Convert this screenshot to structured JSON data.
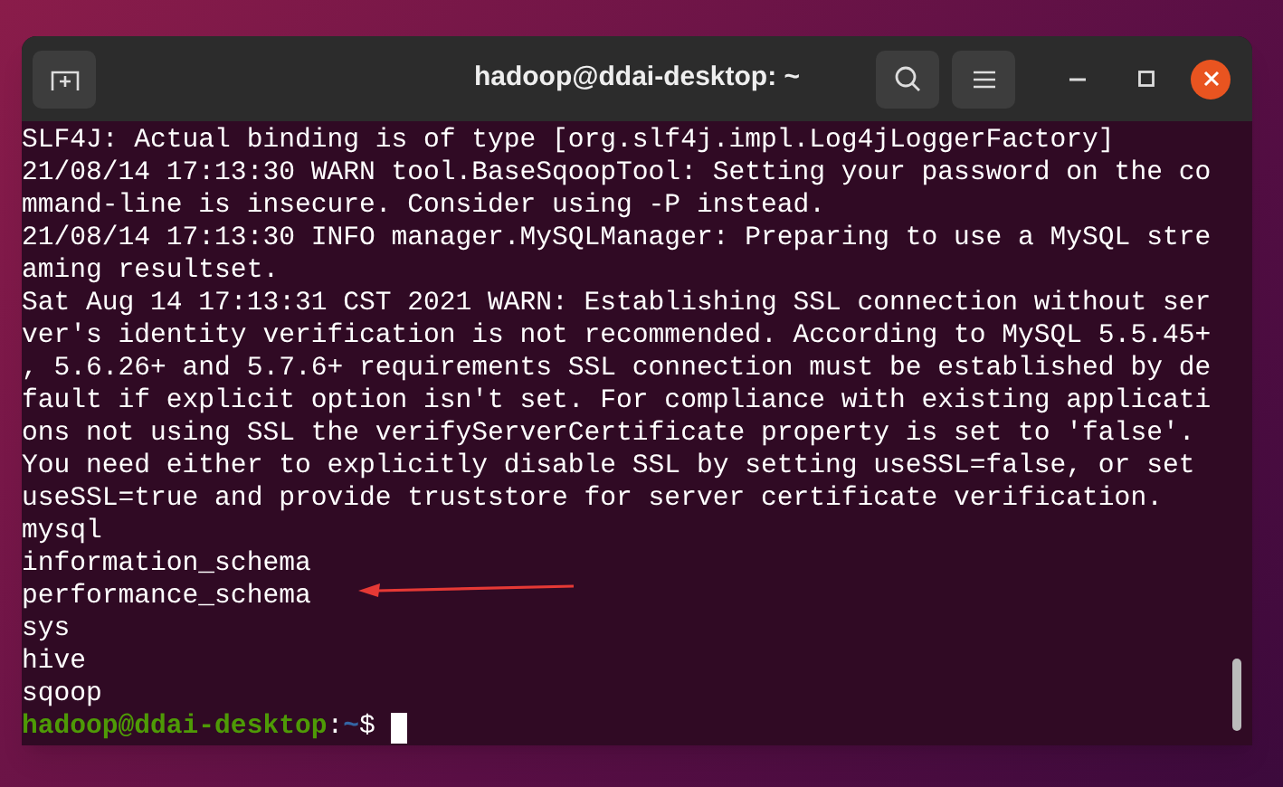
{
  "window": {
    "title": "hadoop@ddai-desktop: ~"
  },
  "output_lines": [
    "SLF4J: Actual binding is of type [org.slf4j.impl.Log4jLoggerFactory]",
    "21/08/14 17:13:30 WARN tool.BaseSqoopTool: Setting your password on the co",
    "mmand-line is insecure. Consider using -P instead.",
    "21/08/14 17:13:30 INFO manager.MySQLManager: Preparing to use a MySQL stre",
    "aming resultset.",
    "Sat Aug 14 17:13:31 CST 2021 WARN: Establishing SSL connection without ser",
    "ver's identity verification is not recommended. According to MySQL 5.5.45+",
    ", 5.6.26+ and 5.7.6+ requirements SSL connection must be established by de",
    "fault if explicit option isn't set. For compliance with existing applicati",
    "ons not using SSL the verifyServerCertificate property is set to 'false'.",
    "You need either to explicitly disable SSL by setting useSSL=false, or set",
    "useSSL=true and provide truststore for server certificate verification.",
    "mysql",
    "information_schema",
    "performance_schema",
    "sys",
    "hive",
    "sqoop"
  ],
  "prompt": {
    "user_host": "hadoop@ddai-desktop",
    "separator": ":",
    "path": "~",
    "symbol": "$"
  }
}
